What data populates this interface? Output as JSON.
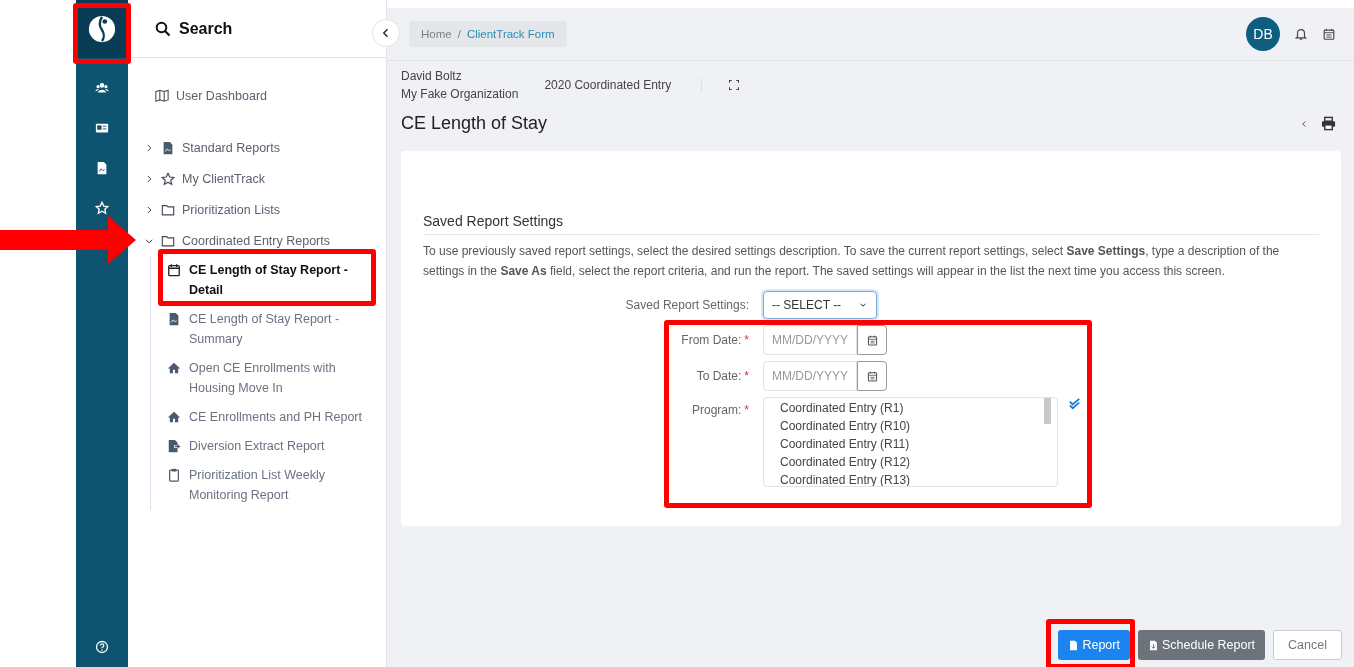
{
  "sidebar": {
    "search_label": "Search",
    "items": [
      {
        "label": "User Dashboard",
        "kind": "link"
      },
      {
        "label": "Standard Reports",
        "kind": "group",
        "expanded": false
      },
      {
        "label": "My ClientTrack",
        "kind": "group",
        "expanded": false
      },
      {
        "label": "Prioritization Lists",
        "kind": "group",
        "expanded": false
      },
      {
        "label": "Coordinated Entry Reports",
        "kind": "group",
        "expanded": true,
        "children": [
          {
            "label": "CE Length of Stay Report - Detail",
            "selected": true
          },
          {
            "label": "CE Length of Stay Report - Summary",
            "selected": false
          },
          {
            "label": "Open CE Enrollments with Housing Move In",
            "selected": false
          },
          {
            "label": "CE Enrollments and PH Report",
            "selected": false
          },
          {
            "label": "Diversion Extract Report",
            "selected": false
          },
          {
            "label": "Prioritization List Weekly Monitoring Report",
            "selected": false
          }
        ]
      }
    ]
  },
  "breadcrumb": {
    "separator": "/",
    "items": [
      {
        "label": "Home",
        "current": false
      },
      {
        "label": "ClientTrack Form",
        "current": true
      }
    ]
  },
  "user": {
    "initials": "DB"
  },
  "context": {
    "client": "David Boltz",
    "organization": "My Fake Organization",
    "program": "2020 Coordinated Entry"
  },
  "page_title": "CE Length of Stay",
  "section": {
    "title": "Saved Report Settings",
    "description": "To use previously saved report settings, select the desired settings description. To save the current report settings, select **Save Settings**, type a description of the settings in the **Save As** field, select the report criteria, and run the report. The saved settings will appear in the list the next time you access this screen."
  },
  "fields": [
    {
      "kind": "select",
      "label": "Saved Report Settings:",
      "value": "-- SELECT --"
    },
    {
      "kind": "date",
      "label": "From Date:",
      "required_mark": "*",
      "placeholder": "MM/DD/YYYY"
    },
    {
      "kind": "date",
      "label": "To Date:",
      "required_mark": "*",
      "placeholder": "MM/DD/YYYY"
    },
    {
      "kind": "listbox",
      "label": "Program:",
      "required_mark": "*",
      "options": [
        {
          "label": "Coordinated Entry (R1)",
          "selected": false
        },
        {
          "label": "Coordinated Entry (R10)",
          "selected": false
        },
        {
          "label": "Coordinated Entry (R11)",
          "selected": false
        },
        {
          "label": "Coordinated Entry (R12)",
          "selected": false
        },
        {
          "label": "Coordinated Entry (R13)",
          "selected": false
        }
      ]
    }
  ],
  "buttons": [
    {
      "label": "Report",
      "kind": "primary"
    },
    {
      "label": "Schedule Report",
      "kind": "secondary"
    },
    {
      "label": "Cancel",
      "kind": "outline"
    }
  ]
}
